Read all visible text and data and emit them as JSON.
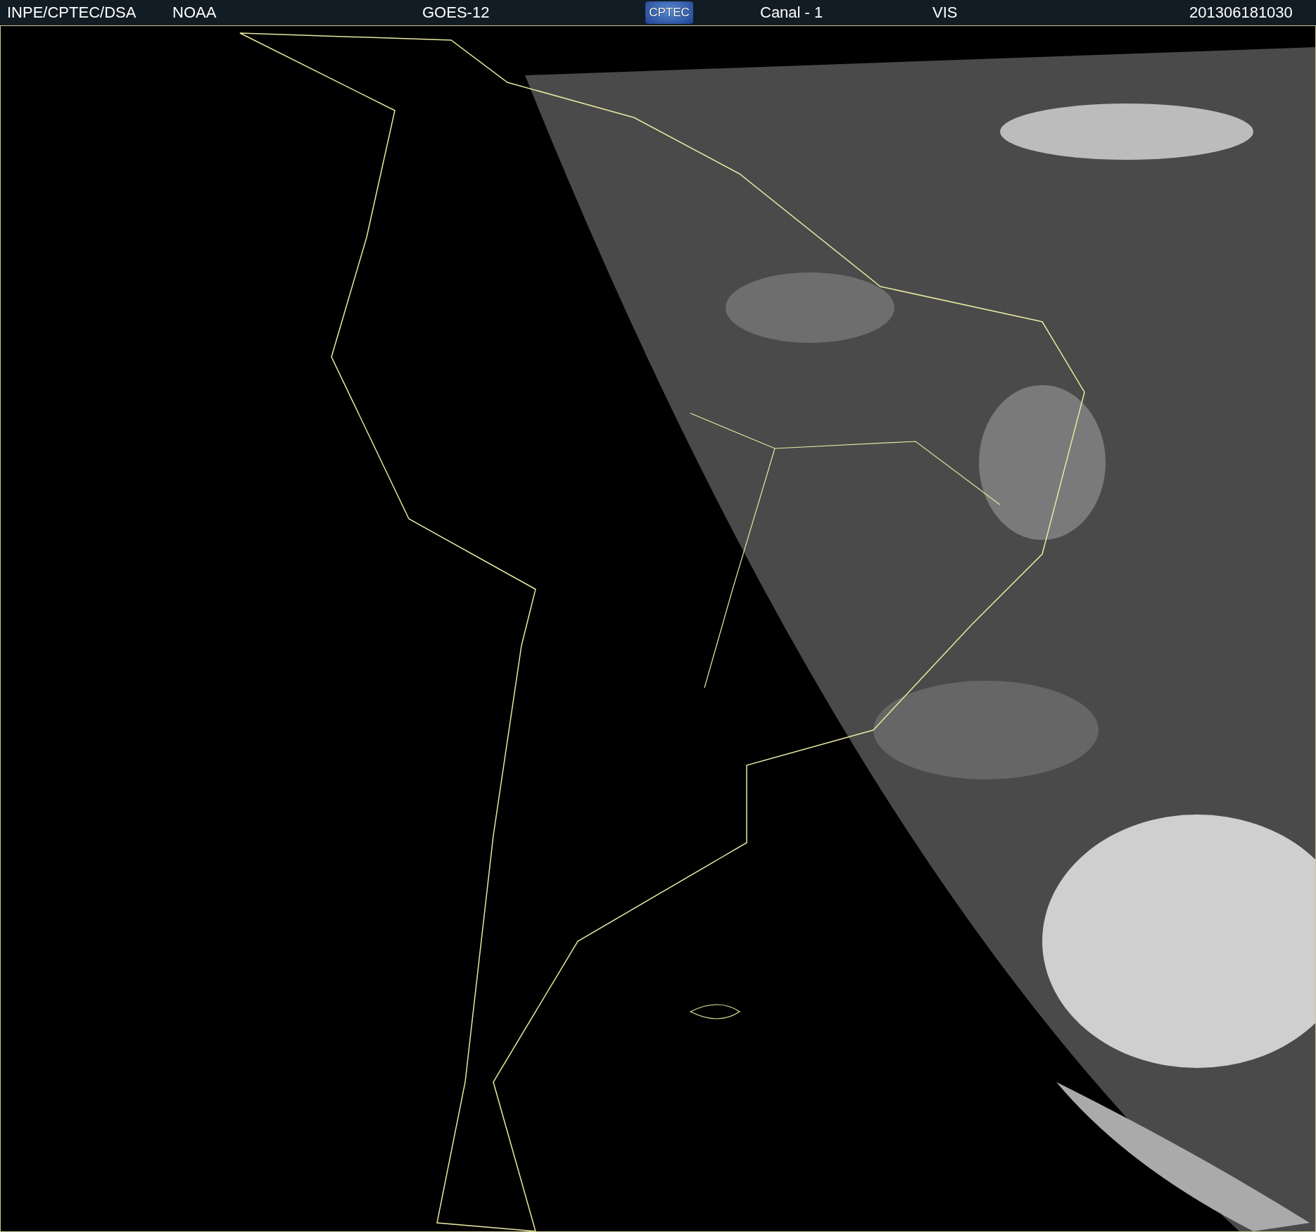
{
  "header": {
    "source": "INPE/CPTEC/DSA",
    "agency": "NOAA",
    "satellite": "GOES-12",
    "logo": "CPTEC",
    "channel": "Canal - 1",
    "band": "VIS",
    "timestamp": "201306181030"
  }
}
